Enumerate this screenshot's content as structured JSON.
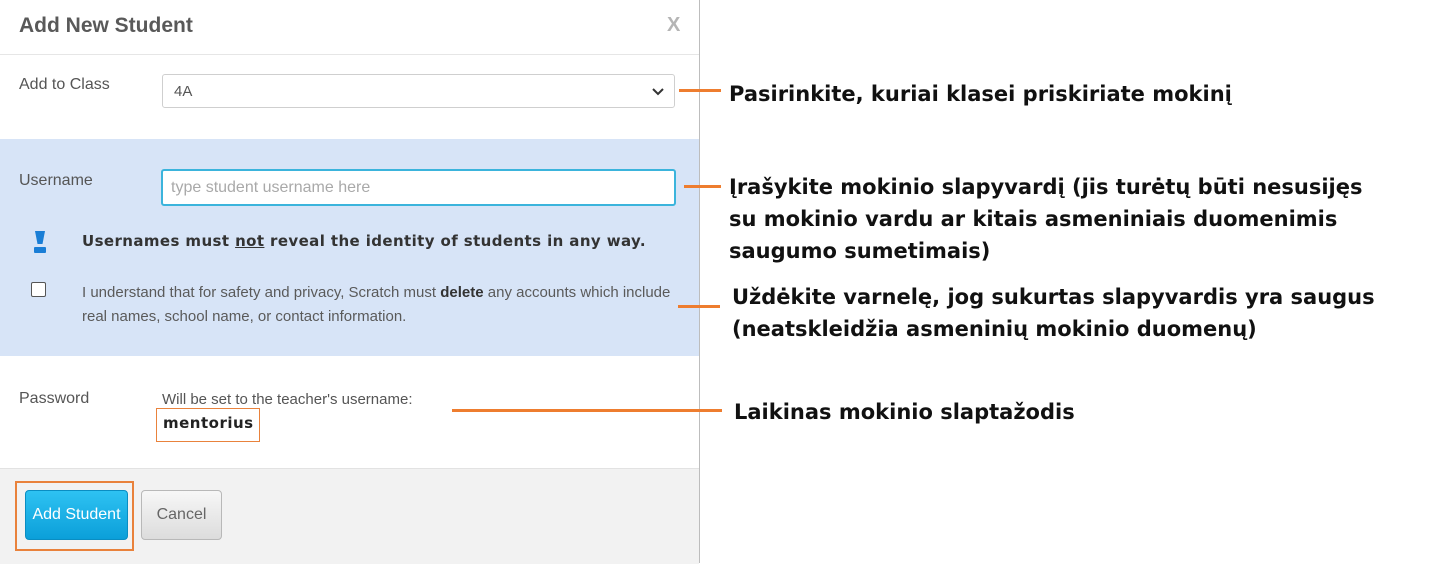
{
  "modal": {
    "title": "Add New Student",
    "close_label": "X",
    "add_to_class_label": "Add to Class",
    "class_selected": "4A",
    "username_label": "Username",
    "username_value": "",
    "username_placeholder": "type student username here",
    "warning_pre": "Usernames must ",
    "warning_emph": "not",
    "warning_post": " reveal the identity of students in any way.",
    "understand_pre": "I understand that for safety and privacy, Scratch must ",
    "understand_bold": "delete",
    "understand_post": " any accounts which include real names, school name, or contact information.",
    "understand_checked": false,
    "password_label": "Password",
    "password_note": "Will be set to the teacher's username:",
    "password_value": "mentorius",
    "add_button": "Add Student",
    "cancel_button": "Cancel"
  },
  "annotations": {
    "class_hint": "Pasirinkite, kuriai klasei priskiriate mokinį",
    "username_hint": "Įrašykite mokinio slapyvardį (jis turėtų būti nesusijęs\nsu mokinio vardu ar kitais asmeniniais duomenimis\nsaugumo sumetimais)",
    "checkbox_hint": "Uždėkite varnelę, jog sukurtas slapyvardis yra saugus\n(neatskleidžia asmeninių mokinio duomenų)",
    "password_hint": "Laikinas mokinio slaptažodis"
  },
  "colors": {
    "accent_orange": "#ee7d2f",
    "section_blue": "#d7e4f7",
    "button_blue": "#0b9fd9",
    "input_focus": "#3bb4dc"
  },
  "icons": [
    "chevron-down-icon",
    "exclamation-icon"
  ]
}
